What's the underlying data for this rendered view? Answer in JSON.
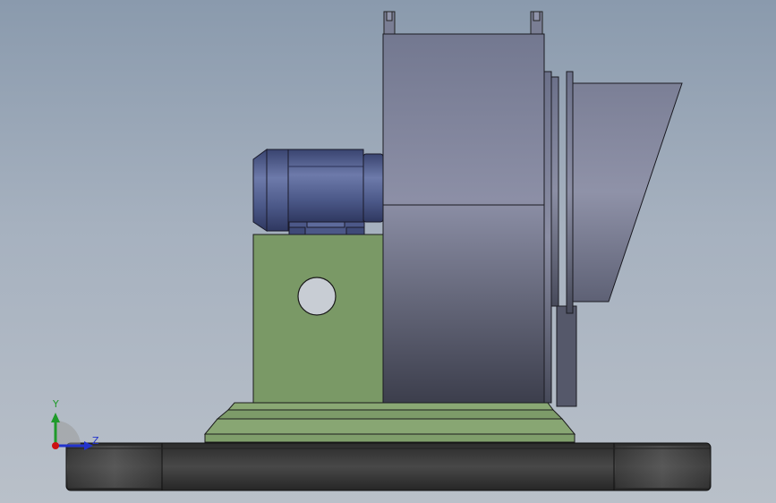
{
  "viewport": {
    "model": "centrifugal-fan-assembly",
    "view": "side-elevation"
  },
  "triad": {
    "y_label": "Y",
    "z_label": "Z",
    "y_color": "#1f9a2a",
    "z_color": "#2233cc",
    "origin_color": "#cc1111"
  },
  "colors": {
    "frame_green": "#7b9a67",
    "motor_blue": "#4d5c8c",
    "housing_gray": "#6f7487",
    "base_dark": "#3f3f3f"
  }
}
